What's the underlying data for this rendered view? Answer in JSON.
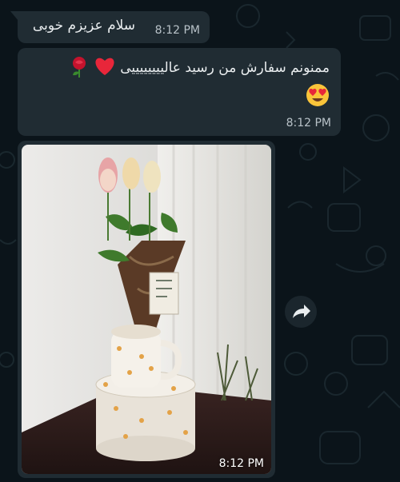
{
  "messages": [
    {
      "text": "سلام عزیزم خوبی",
      "time": "8:12 PM"
    },
    {
      "text": "ممنونم سفارش من رسید عالییییییییی",
      "time": "8:12 PM"
    },
    {
      "time": "8:12 PM"
    }
  ],
  "icons": {
    "heart": "heart-icon",
    "rose": "rose-icon",
    "heart_eyes": "heart-eyes-emoji-icon",
    "forward": "forward-icon"
  },
  "colors": {
    "background": "#0b141a",
    "bubble": "#202c33",
    "text": "#e9edef",
    "time": "#b8c2c8"
  }
}
